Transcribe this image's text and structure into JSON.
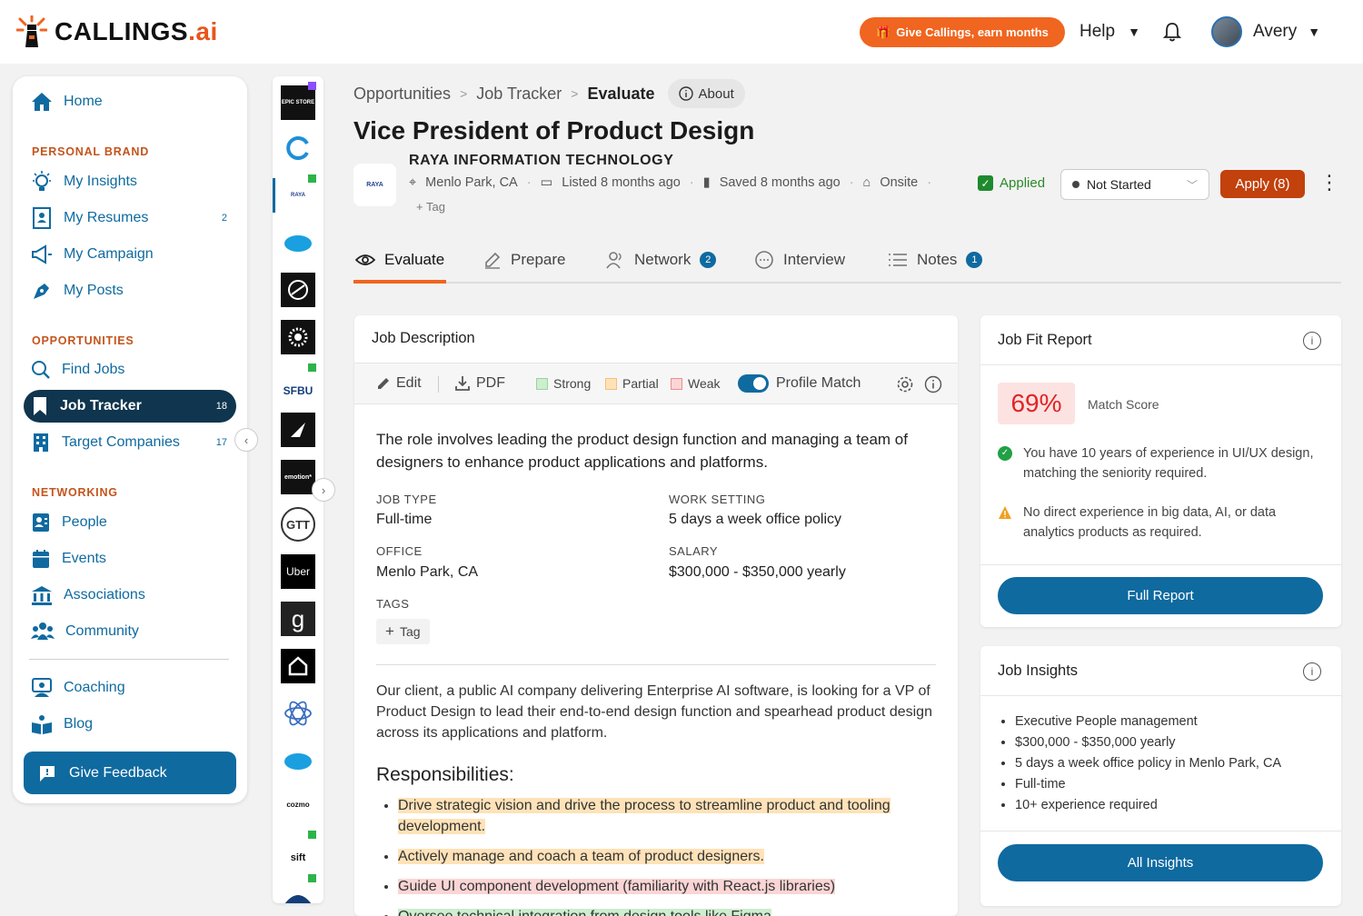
{
  "brand": {
    "name": "CALLINGS",
    "suffix": ".ai"
  },
  "topbar": {
    "promo": "Give Callings, earn months",
    "help": "Help",
    "user": "Avery"
  },
  "sidebar": {
    "home": "Home",
    "personal_brand_head": "PERSONAL BRAND",
    "my_insights": "My Insights",
    "my_resumes": "My Resumes",
    "my_resumes_count": "2",
    "my_campaign": "My Campaign",
    "my_posts": "My Posts",
    "opportunities_head": "OPPORTUNITIES",
    "find_jobs": "Find Jobs",
    "job_tracker": "Job Tracker",
    "job_tracker_count": "18",
    "target_companies": "Target Companies",
    "target_companies_count": "17",
    "networking_head": "NETWORKING",
    "people": "People",
    "events": "Events",
    "associations": "Associations",
    "community": "Community",
    "coaching": "Coaching",
    "blog": "Blog",
    "feedback": "Give Feedback"
  },
  "strip": {
    "epic": "EPIC STORE",
    "sfbu": "SFBU",
    "emotion": "emotion*",
    "gtt": "GTT",
    "uber": "Uber",
    "g": "g",
    "salesforce": "salesforce",
    "cozmo": "cozmo",
    "sift": "sift"
  },
  "breadcrumb": {
    "opportunities": "Opportunities",
    "job_tracker": "Job Tracker",
    "current": "Evaluate",
    "about": "About"
  },
  "job": {
    "title": "Vice President of Product Design",
    "company": "RAYA INFORMATION TECHNOLOGY",
    "location": "Menlo Park, CA",
    "listed": "Listed 8 months ago",
    "saved": "Saved 8 months ago",
    "work_mode": "Onsite",
    "tag_label": "Tag",
    "applied_label": "Applied",
    "status": "Not Started",
    "apply_label": "Apply (8)"
  },
  "tabs": [
    {
      "label": "Evaluate"
    },
    {
      "label": "Prepare"
    },
    {
      "label": "Network",
      "badge": "2"
    },
    {
      "label": "Interview"
    },
    {
      "label": "Notes",
      "badge": "1"
    }
  ],
  "jd": {
    "card_title": "Job Description",
    "edit": "Edit",
    "pdf": "PDF",
    "strong": "Strong",
    "partial": "Partial",
    "weak": "Weak",
    "profile_match": "Profile Match",
    "summary": "The role involves leading the product design function and managing a team of designers to enhance product applications and platforms.",
    "job_type_label": "JOB TYPE",
    "job_type": "Full-time",
    "work_setting_label": "WORK SETTING",
    "work_setting": "5 days a week office policy",
    "office_label": "OFFICE",
    "office": "Menlo Park, CA",
    "salary_label": "SALARY",
    "salary": "$300,000 - $350,000 yearly",
    "tags_label": "TAGS",
    "tag_chip": "Tag",
    "body": "Our client, a public AI company delivering Enterprise AI software, is looking for a VP of Product Design to lead their end-to-end design function and spearhead product design across its applications and platform.",
    "responsibilities_head": "Responsibilities:",
    "responsibilities": [
      "Drive strategic vision and drive the process to streamline product and tooling development.",
      "Actively manage and coach a team of product designers.",
      "Guide UI component development (familiarity with React.js libraries)",
      "Oversee technical integration from design tools like Figma"
    ]
  },
  "fit": {
    "title": "Job Fit Report",
    "score": "69%",
    "score_label": "Match Score",
    "positive": "You have 10 years of experience in UI/UX design, matching the seniority required.",
    "negative": "No direct experience in big data, AI, or data analytics products as required.",
    "button": "Full Report"
  },
  "insights": {
    "title": "Job Insights",
    "items": [
      "Executive People management",
      "$300,000 - $350,000 yearly",
      "5 days a week office policy in Menlo Park, CA",
      "Full-time",
      "10+ experience required"
    ],
    "button": "All Insights"
  },
  "colors": {
    "accent": "#f0651f",
    "primary": "#0f6aa0",
    "dark": "#10354e",
    "apply": "#c2410c"
  }
}
